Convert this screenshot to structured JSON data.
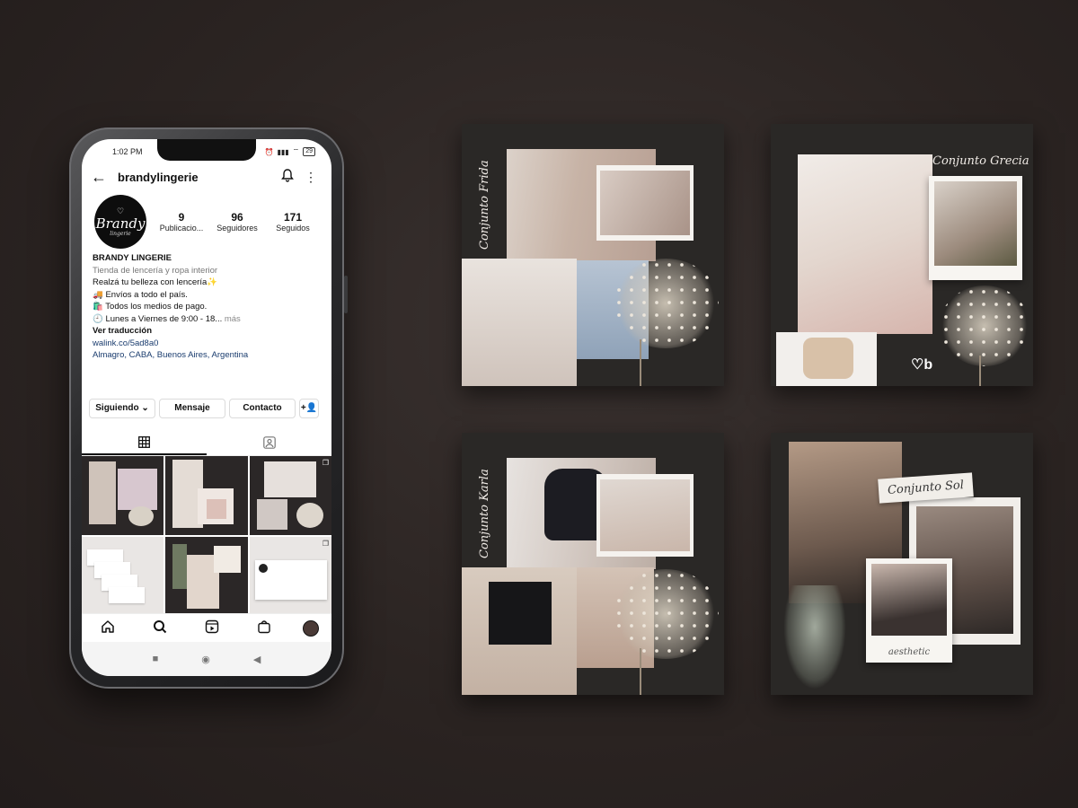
{
  "phone": {
    "status": {
      "time": "1:02 PM",
      "battery": "29"
    },
    "topbar": {
      "back_icon": "arrow-left-icon",
      "username": "brandylingerie",
      "bell_icon": "bell-icon",
      "menu_icon": "more-vertical-icon"
    },
    "profile": {
      "avatar": {
        "logo_text": "Brandy",
        "logo_sub": "lingerie"
      },
      "stats": [
        {
          "num": "9",
          "label": "Publicacio..."
        },
        {
          "num": "96",
          "label": "Seguidores"
        },
        {
          "num": "171",
          "label": "Seguidos"
        }
      ],
      "bio": {
        "name": "BRANDY LINGERIE",
        "category": "Tienda de lencería y ropa interior",
        "line1": "Realzá tu belleza con lencería✨",
        "line2": "🚚 Envíos a todo el país.",
        "line3": "🛍️ Todos los medios de pago.",
        "line4": "🕘 Lunes a Viernes de 9:00 - 18...",
        "more": "más",
        "translate": "Ver traducción",
        "link": "walink.co/5ad8a0",
        "location": "Almagro, CABA, Buenos Aires, Argentina"
      }
    },
    "actions": {
      "following": "Siguiendo ⌄",
      "message": "Mensaje",
      "contact": "Contacto",
      "add_user_icon": "add-user-icon"
    },
    "tabs": [
      {
        "icon": "grid-icon"
      },
      {
        "icon": "tagged-icon"
      }
    ],
    "bottomnav": [
      "home-icon",
      "search-icon",
      "reels-icon",
      "shop-icon",
      "profile-avatar"
    ],
    "sysnav": [
      "■",
      "◉",
      "◀"
    ]
  },
  "cards": {
    "c1": {
      "script": "Conjunto Frida"
    },
    "c2": {
      "script": "Conjunto Grecia"
    },
    "c3": {
      "script": "Conjunto Karla"
    },
    "c4": {
      "script": "Conjunto Sol",
      "polaroid_caption": "aesthetic"
    }
  },
  "colors": {
    "background": "#2b2422",
    "card": "#2a2826",
    "paper": "#f5f2ee"
  }
}
